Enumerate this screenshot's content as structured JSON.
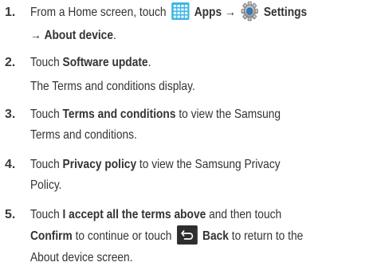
{
  "steps": [
    {
      "number": "1.",
      "lines": [
        {
          "a": "From a Home screen, touch",
          "b": "Apps",
          "arrow": "→",
          "c": "Settings"
        },
        {
          "arrow": "→",
          "b": "About device",
          "end": "."
        }
      ]
    },
    {
      "number": "2.",
      "lines": [
        {
          "a": "Touch ",
          "b": "Software update",
          "end": "."
        },
        {
          "a": "The Terms and conditions display."
        }
      ]
    },
    {
      "number": "3.",
      "lines": [
        {
          "a": "Touch ",
          "b": "Terms and conditions",
          "c": " to view the Samsung"
        },
        {
          "a": "Terms and conditions."
        }
      ]
    },
    {
      "number": "4.",
      "lines": [
        {
          "a": "Touch ",
          "b": "Privacy policy",
          "c": " to view the Samsung Privacy"
        },
        {
          "a": "Policy."
        }
      ]
    },
    {
      "number": "5.",
      "lines": [
        {
          "a": "Touch ",
          "b": "I accept all the terms above",
          "c": " and then touch"
        },
        {
          "b": "Confirm",
          "c": " to continue or touch",
          "d": "Back",
          "e": " to return to the"
        },
        {
          "a": "About device screen."
        }
      ]
    }
  ],
  "icons": {
    "apps": "apps-grid-icon",
    "settings": "settings-gear-icon",
    "back": "back-arrow-icon"
  },
  "colors": {
    "apps_icon": "#3db7e5",
    "back_icon": "#2e2e2e",
    "text": "#333333"
  }
}
